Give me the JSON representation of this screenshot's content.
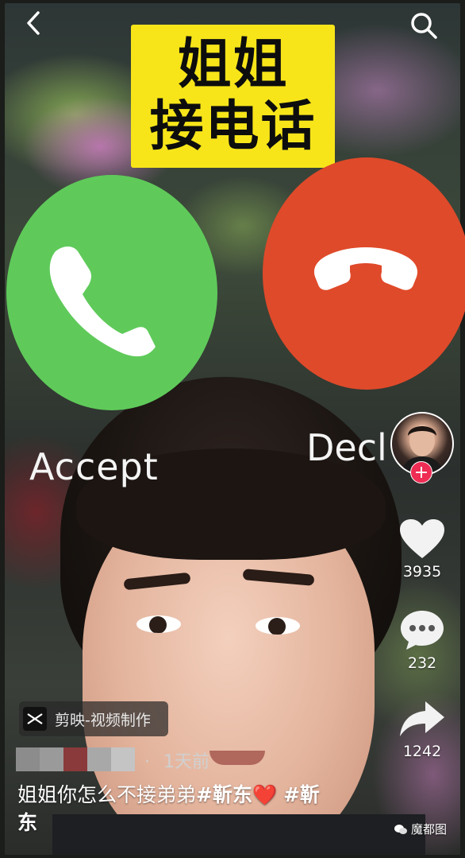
{
  "video": {
    "title_line1": "姐姐",
    "title_line2": "接电话",
    "accept_label": "Accept",
    "decline_label": "Decl"
  },
  "right_rail": {
    "like_count": "3935",
    "comment_count": "232",
    "share_count": "1242"
  },
  "bottom": {
    "app_tag": "剪映-视频制作",
    "time_dot": "·",
    "time_ago": "1天前",
    "caption_text": "姐姐你怎么不接弟弟",
    "caption_tag1": "#靳东",
    "caption_heart": "❤️",
    "caption_tag2": "#靳东",
    "watermark": "魔都图"
  },
  "colors": {
    "accept_green": "#5fca5a",
    "decline_red": "#df4a2a",
    "title_yellow": "#f7e51a",
    "follow_pink": "#ee2c54"
  },
  "icons": [
    "back-arrow-icon",
    "search-icon",
    "phone-accept-icon",
    "phone-decline-icon",
    "heart-icon",
    "comment-icon",
    "share-icon",
    "plus-icon",
    "capcut-icon",
    "wechat-icon"
  ]
}
